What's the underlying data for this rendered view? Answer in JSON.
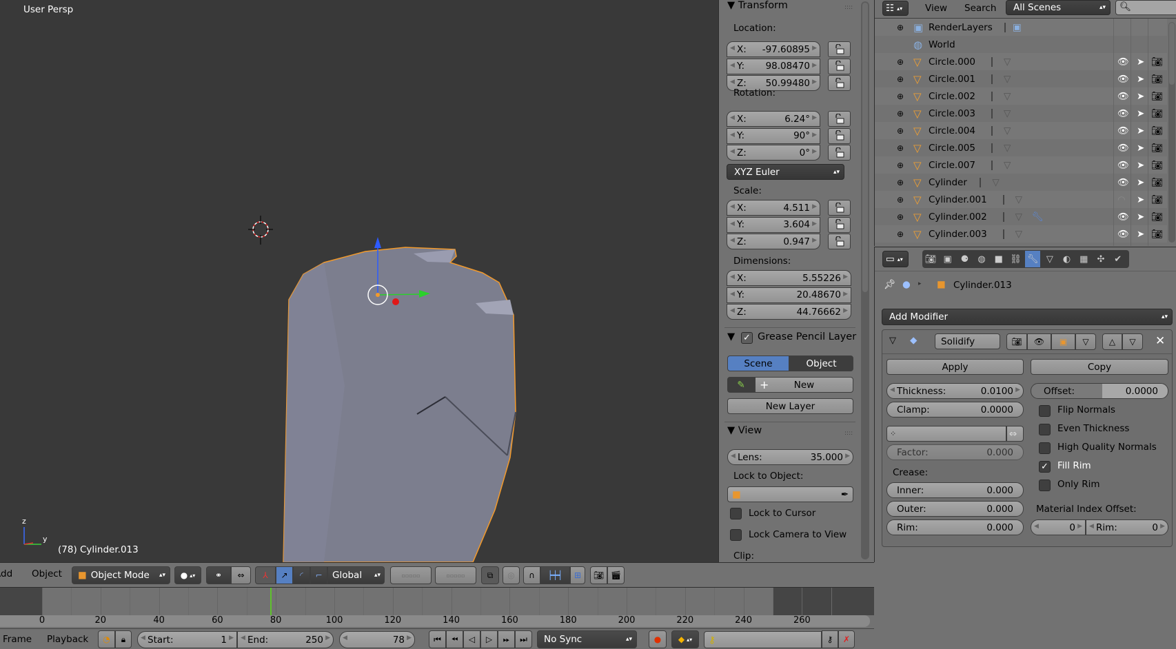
{
  "viewport": {
    "view_name": "User Persp",
    "object_info": "(78) Cylinder.013",
    "axis_labels": {
      "z": "z",
      "y": "y"
    },
    "colors": {
      "background": "#393939",
      "mesh": "#7c7e8e",
      "selection_outline": "#f39a2b"
    }
  },
  "npanel": {
    "transform": {
      "title": "Transform",
      "location_label": "Location:",
      "location": [
        {
          "axis": "X:",
          "value": "-97.60895"
        },
        {
          "axis": "Y:",
          "value": "98.08470"
        },
        {
          "axis": "Z:",
          "value": "50.99480"
        }
      ],
      "rotation_label": "Rotation:",
      "rotation": [
        {
          "axis": "X:",
          "value": "6.24°"
        },
        {
          "axis": "Y:",
          "value": "90°"
        },
        {
          "axis": "Z:",
          "value": "0°"
        }
      ],
      "rotation_mode": "XYZ Euler",
      "scale_label": "Scale:",
      "scale": [
        {
          "axis": "X:",
          "value": "4.511"
        },
        {
          "axis": "Y:",
          "value": "3.604"
        },
        {
          "axis": "Z:",
          "value": "0.947"
        }
      ],
      "dimensions_label": "Dimensions:",
      "dimensions": [
        {
          "axis": "X:",
          "value": "5.55226"
        },
        {
          "axis": "Y:",
          "value": "20.48670"
        },
        {
          "axis": "Z:",
          "value": "44.76662"
        }
      ]
    },
    "grease_pencil": {
      "title": "Grease Pencil Layer",
      "enabled": true,
      "scene_tab": "Scene",
      "object_tab": "Object",
      "active_tab": "Scene",
      "new_label": "New",
      "new_layer_label": "New Layer"
    },
    "view": {
      "title": "View",
      "lens_label": "Lens:",
      "lens_value": "35.000",
      "lock_object_label": "Lock to Object:",
      "lock_cursor_label": "Lock to Cursor",
      "lock_cursor": false,
      "lock_camera_label": "Lock Camera to View",
      "lock_camera": false,
      "clip_label": "Clip:"
    }
  },
  "outliner": {
    "menu_view": "View",
    "menu_search": "Search",
    "display_mode": "All Scenes",
    "rows": [
      {
        "name": "RenderLayers",
        "icon": "render-layers-icon",
        "expandable": true,
        "restrict": false
      },
      {
        "name": "World",
        "icon": "world-icon",
        "expandable": false,
        "restrict": false
      },
      {
        "name": "Circle.000",
        "icon": "mesh-object-icon",
        "expandable": true,
        "restrict": true,
        "visible": true
      },
      {
        "name": "Circle.001",
        "icon": "mesh-object-icon",
        "expandable": true,
        "restrict": true,
        "visible": true
      },
      {
        "name": "Circle.002",
        "icon": "mesh-object-icon",
        "expandable": true,
        "restrict": true,
        "visible": true
      },
      {
        "name": "Circle.003",
        "icon": "mesh-object-icon",
        "expandable": true,
        "restrict": true,
        "visible": true
      },
      {
        "name": "Circle.004",
        "icon": "mesh-object-icon",
        "expandable": true,
        "restrict": true,
        "visible": true
      },
      {
        "name": "Circle.005",
        "icon": "mesh-object-icon",
        "expandable": true,
        "restrict": true,
        "visible": true
      },
      {
        "name": "Circle.007",
        "icon": "mesh-object-icon",
        "expandable": true,
        "restrict": true,
        "visible": true
      },
      {
        "name": "Cylinder",
        "icon": "mesh-object-icon",
        "expandable": true,
        "restrict": true,
        "visible": true
      },
      {
        "name": "Cylinder.001",
        "icon": "mesh-object-icon",
        "expandable": true,
        "restrict": true,
        "visible": false
      },
      {
        "name": "Cylinder.002",
        "icon": "mesh-object-icon",
        "expandable": true,
        "restrict": true,
        "visible": true,
        "modifier": true
      },
      {
        "name": "Cylinder.003",
        "icon": "mesh-object-icon",
        "expandable": true,
        "restrict": true,
        "visible": true
      }
    ]
  },
  "properties": {
    "tabs": [
      "render-icon",
      "render-layers-icon",
      "scene-icon",
      "world-icon",
      "object-icon",
      "constraints-icon",
      "modifiers-icon",
      "data-icon",
      "material-icon",
      "texture-icon",
      "particles-icon",
      "physics-icon"
    ],
    "active_tab": "modifiers-icon",
    "breadcrumb_object": "Cylinder.013",
    "add_modifier": "Add Modifier",
    "modifier": {
      "name": "Solidify",
      "apply": "Apply",
      "copy": "Copy",
      "thickness_label": "Thickness:",
      "thickness": "0.0100",
      "offset_label": "Offset:",
      "offset": "0.0000",
      "clamp_label": "Clamp:",
      "clamp": "0.0000",
      "factor_label": "Factor:",
      "factor": "0.000",
      "crease_label": "Crease:",
      "inner_label": "Inner:",
      "inner": "0.000",
      "outer_label": "Outer:",
      "outer": "0.000",
      "rim_label": "Rim:",
      "rim": "0.000",
      "options": [
        {
          "label": "Flip Normals",
          "checked": false
        },
        {
          "label": "Even Thickness",
          "checked": false
        },
        {
          "label": "High Quality Normals",
          "checked": false
        },
        {
          "label": "Fill Rim",
          "checked": true
        },
        {
          "label": "Only Rim",
          "checked": false
        }
      ],
      "material_offset_label": "Material Index Offset:",
      "material_offset": "0",
      "material_rim_label": "Rim:",
      "material_rim": "0"
    }
  },
  "view3d_header": {
    "menu_add": "Add",
    "menu_object": "Object",
    "mode": "Object Mode",
    "orientation": "Global"
  },
  "timeline": {
    "ticks": [
      "0",
      "20",
      "40",
      "60",
      "80",
      "100",
      "120",
      "140",
      "160",
      "180",
      "200",
      "220",
      "240",
      "260"
    ],
    "current_frame_value": 78,
    "start_frame_value": 1,
    "end_frame_value": 250,
    "menu_frame": "Frame",
    "menu_playback": "Playback",
    "start_label": "Start:",
    "start": "1",
    "end_label": "End:",
    "end": "250",
    "current": "78",
    "sync": "No Sync",
    "colors": {
      "playhead": "#5fc22c"
    }
  }
}
